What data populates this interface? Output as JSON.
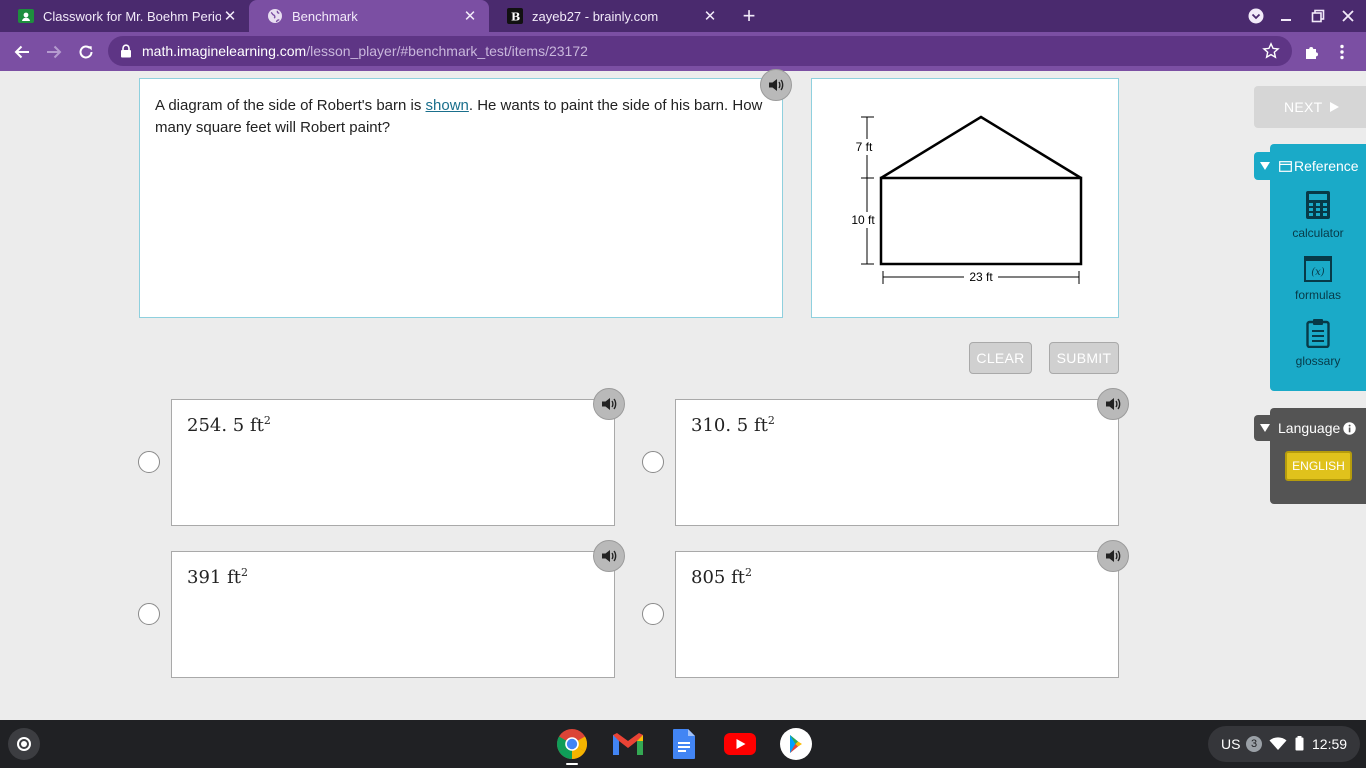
{
  "browser": {
    "tabs": [
      {
        "title": "Classwork for Mr. Boehm Period",
        "active": false,
        "favicon": "google-classroom-icon"
      },
      {
        "title": "Benchmark",
        "active": true,
        "favicon": "globe-icon"
      },
      {
        "title": "zayeb27 - brainly.com",
        "active": false,
        "favicon": "brainly-icon"
      }
    ],
    "url_host": "math.imaginelearning.com",
    "url_path": "/lesson_player/#benchmark_test/items/23172",
    "colors": {
      "tabbar": "#4a2a6e",
      "toolbar": "#7b4fa3"
    }
  },
  "question": {
    "text_before": "A diagram of the side of Robert's barn is ",
    "link_text": "shown",
    "text_after": ". He wants to paint the side of his barn. How many square feet will Robert paint?"
  },
  "diagram": {
    "label_roof": "7 ft",
    "label_wall": "10 ft",
    "label_width": "23 ft"
  },
  "actions": {
    "clear_label": "CLEAR",
    "submit_label": "SUBMIT",
    "next_label": "NEXT"
  },
  "answers": [
    {
      "base": "254. 5 ft",
      "exp": "2"
    },
    {
      "base": "310. 5 ft",
      "exp": "2"
    },
    {
      "base": "391 ft",
      "exp": "2"
    },
    {
      "base": "805 ft",
      "exp": "2"
    }
  ],
  "reference": {
    "title": "Reference",
    "items": [
      {
        "label": "calculator",
        "icon": "calculator-icon"
      },
      {
        "label": "formulas",
        "icon": "formulas-icon"
      },
      {
        "label": "glossary",
        "icon": "clipboard-icon"
      }
    ],
    "color": "#1aaac8"
  },
  "language": {
    "title": "Language",
    "option": "ENGLISH"
  },
  "shelf": {
    "apps": [
      "chrome-icon",
      "gmail-icon",
      "docs-icon",
      "youtube-icon",
      "play-store-icon"
    ],
    "locale": "US",
    "notification_count": "3",
    "time": "12:59"
  }
}
